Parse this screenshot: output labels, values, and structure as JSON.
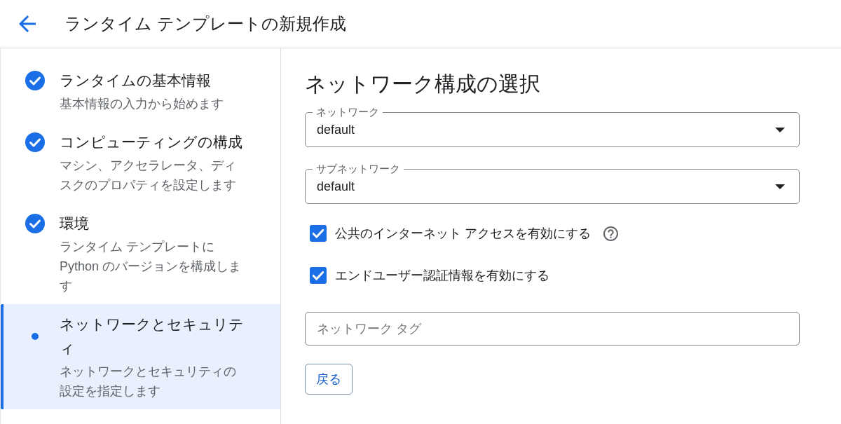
{
  "header": {
    "title": "ランタイム テンプレートの新規作成"
  },
  "steps": [
    {
      "title": "ランタイムの基本情報",
      "subtitle": "基本情報の入力から始めます",
      "completed": true,
      "selected": false
    },
    {
      "title": "コンピューティングの構成",
      "subtitle": "マシン、アクセラレータ、ディスクのプロパティを設定します",
      "completed": true,
      "selected": false
    },
    {
      "title": "環境",
      "subtitle": "ランタイム テンプレートに Python のバージョンを構成します",
      "completed": true,
      "selected": false
    },
    {
      "title": "ネットワークとセキュリティ",
      "subtitle": "ネットワークとセキュリティの設定を指定します",
      "completed": false,
      "selected": true
    }
  ],
  "main": {
    "heading": "ネットワーク構成の選択",
    "selects": [
      {
        "label": "ネットワーク",
        "value": "default"
      },
      {
        "label": "サブネットワーク",
        "value": "default"
      }
    ],
    "options": [
      {
        "label": "公共のインターネット アクセスを有効にする",
        "checked": true,
        "help": true
      },
      {
        "label": "エンドユーザー認証情報を有効にする",
        "checked": true,
        "help": false
      }
    ],
    "tags_field": {
      "placeholder": "ネットワーク タグ"
    },
    "back_button": "戻る"
  }
}
